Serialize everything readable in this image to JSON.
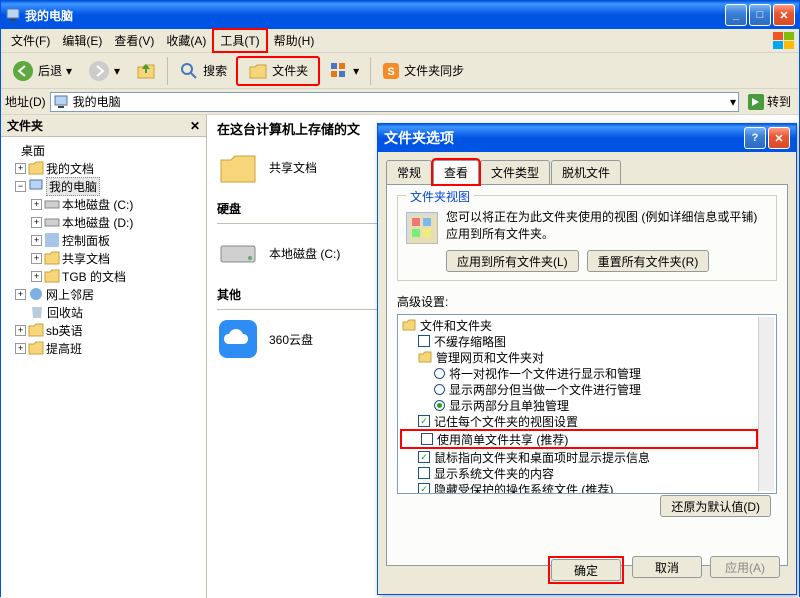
{
  "window_title": "我的电脑",
  "menu": {
    "file": "文件(F)",
    "edit": "编辑(E)",
    "view": "查看(V)",
    "fav": "收藏(A)",
    "tools": "工具(T)",
    "help": "帮助(H)"
  },
  "toolbar": {
    "back": "后退",
    "search": "搜索",
    "folders": "文件夹",
    "sync": "文件夹同步"
  },
  "address": {
    "label": "地址(D)",
    "value": "我的电脑",
    "go": "转到"
  },
  "tree": {
    "panel_title": "文件夹",
    "root": "桌面",
    "items": [
      "我的文档",
      "我的电脑",
      "本地磁盘 (C:)",
      "本地磁盘 (D:)",
      "控制面板",
      "共享文档",
      "TGB 的文档",
      "网上邻居",
      "回收站",
      "sb英语",
      "提高班"
    ]
  },
  "content": {
    "header": "在这台计算机上存储的文",
    "shared": "共享文档",
    "cat_hd": "硬盘",
    "drive_c": "本地磁盘 (C:)",
    "cat_other": "其他",
    "cloud": "360云盘"
  },
  "dialog": {
    "title": "文件夹选项",
    "tabs": {
      "general": "常规",
      "view": "查看",
      "filetypes": "文件类型",
      "offline": "脱机文件"
    },
    "view_group": "文件夹视图",
    "view_text": "您可以将正在为此文件夹使用的视图 (例如详细信息或平铺) 应用到所有文件夹。",
    "apply_all": "应用到所有文件夹(L)",
    "reset_all": "重置所有文件夹(R)",
    "adv_label": "高级设置:",
    "adv": {
      "root": "文件和文件夹",
      "nocompact": "不缓存缩略图",
      "pair_group": "管理网页和文件夹对",
      "pair_a": "将一对视作一个文件进行显示和管理",
      "pair_b": "显示两部分但当做一个文件进行管理",
      "pair_c": "显示两部分且单独管理",
      "remember": "记住每个文件夹的视图设置",
      "simple_share": "使用简单文件共享 (推荐)",
      "hover": "鼠标指向文件夹和桌面项时显示提示信息",
      "sysfolders": "显示系统文件夹的内容",
      "hidden": "隐藏受保护的操作系统文件 (推荐)"
    },
    "restore": "还原为默认值(D)",
    "ok": "确定",
    "cancel": "取消",
    "apply": "应用(A)"
  }
}
